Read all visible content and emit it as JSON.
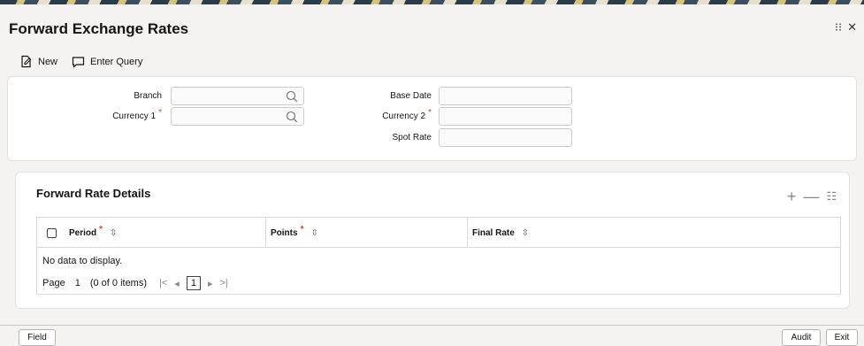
{
  "window": {
    "title": "Forward Exchange Rates"
  },
  "toolbar": {
    "new_label": "New",
    "enter_query_label": "Enter Query"
  },
  "form": {
    "branch_label": "Branch",
    "currency1_label": "Currency 1",
    "base_date_label": "Base Date",
    "currency2_label": "Currency 2",
    "spot_rate_label": "Spot Rate",
    "required_mark": "*",
    "branch_value": "",
    "currency1_value": "",
    "base_date_value": "",
    "currency2_value": "",
    "spot_rate_value": ""
  },
  "details": {
    "title": "Forward Rate Details",
    "columns": [
      "Period",
      "Points",
      "Final Rate"
    ],
    "empty_message": "No data to display.",
    "pager": {
      "page_label": "Page",
      "page_number": "1",
      "items_text": "(0 of 0 items)",
      "current_page": "1"
    }
  },
  "footer": {
    "field_label": "Field",
    "audit_label": "Audit",
    "exit_label": "Exit"
  },
  "colors": {
    "required": "#c74634",
    "text": "#161513",
    "background": "#f4f3f1"
  }
}
